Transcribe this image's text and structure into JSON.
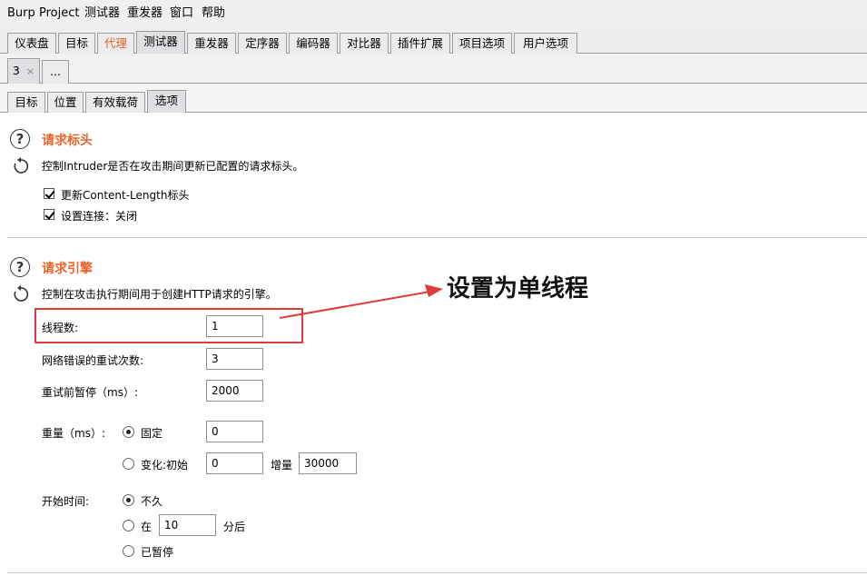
{
  "menu": [
    "Burp",
    "Project",
    "测试器",
    "重发器",
    "窗口",
    "帮助"
  ],
  "main_tabs": [
    "仪表盘",
    "目标",
    "代理",
    "测试器",
    "重发器",
    "定序器",
    "编码器",
    "对比器",
    "插件扩展",
    "项目选项",
    "用户选项"
  ],
  "sub_tabs": {
    "instance": "3",
    "close": "×",
    "more": "..."
  },
  "intruder_tabs": [
    "目标",
    "位置",
    "有效载荷",
    "选项"
  ],
  "request_headers": {
    "title": "请求标头",
    "desc": "控制Intruder是否在攻击期间更新已配置的请求标头。",
    "update_content_length": "更新Content-Length标头",
    "set_connection_close": "设置连接：关闭",
    "update_content_length_checked": true,
    "set_connection_close_checked": true
  },
  "request_engine": {
    "title": "请求引擎",
    "desc": "控制在攻击执行期间用于创建HTTP请求的引擎。",
    "threads_label": "线程数:",
    "threads_value": "1",
    "retries_label": "网络错误的重试次数:",
    "retries_value": "3",
    "pause_label": "重试前暂停（ms）:",
    "pause_value": "2000",
    "throttle_label": "重量（ms）:",
    "fixed_label": "固定",
    "fixed_value": "0",
    "variable_label": "变化:初始",
    "variable_initial_value": "0",
    "increment_label": "增量",
    "increment_value": "30000",
    "start_label": "开始时间:",
    "start_immediately": "不久",
    "start_in": "在",
    "start_in_value": "10",
    "start_in_unit": "分后",
    "start_paused": "已暂停"
  },
  "annotation": "设置为单线程",
  "colors": {
    "accent": "#e8642a",
    "annotation_red": "#e03a3a"
  }
}
